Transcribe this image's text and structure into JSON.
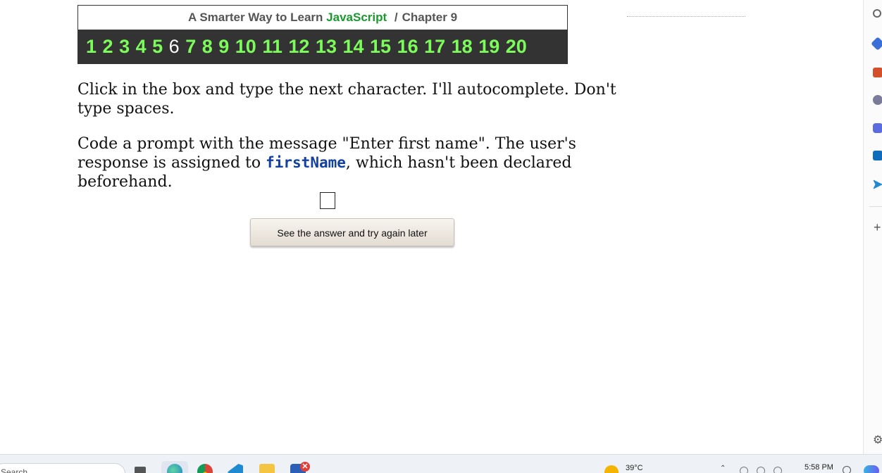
{
  "header": {
    "title_prefix": "A Smarter Way to Learn",
    "title_js": "JavaScript",
    "separator": "/",
    "chapter_label": "Chapter 9",
    "chapters": [
      "1",
      "2",
      "3",
      "4",
      "5",
      "6",
      "7",
      "8",
      "9",
      "10",
      "11",
      "12",
      "13",
      "14",
      "15",
      "16",
      "17",
      "18",
      "19",
      "20"
    ],
    "current_chapter": "6"
  },
  "instructions": {
    "line1": "Click in the box and type the next character. I'll autocomplete. Don't type spaces.",
    "line2_before": "Code a prompt with the message \"Enter first name\". The user's response is assigned to ",
    "line2_code": "firstName",
    "line2_after": ", which hasn't been declared beforehand."
  },
  "answer": {
    "value": ""
  },
  "see_answer_button": {
    "label": "See the answer and try again later"
  },
  "sidebar": {
    "icons": [
      "search-icon",
      "tag-icon",
      "briefcase-icon",
      "people-icon",
      "copilot-icon",
      "outlook-icon",
      "send-icon",
      "plus-icon",
      "gear-icon"
    ]
  },
  "taskbar": {
    "search_placeholder": "Search",
    "temperature": "39°C",
    "time": "5:58 PM",
    "badge": "✕"
  },
  "colors": {
    "accent_green": "#1a9a2e",
    "chapter_link": "#7cfc5a",
    "chapter_bar_bg": "#333333",
    "code_blue": "#1440a0"
  }
}
